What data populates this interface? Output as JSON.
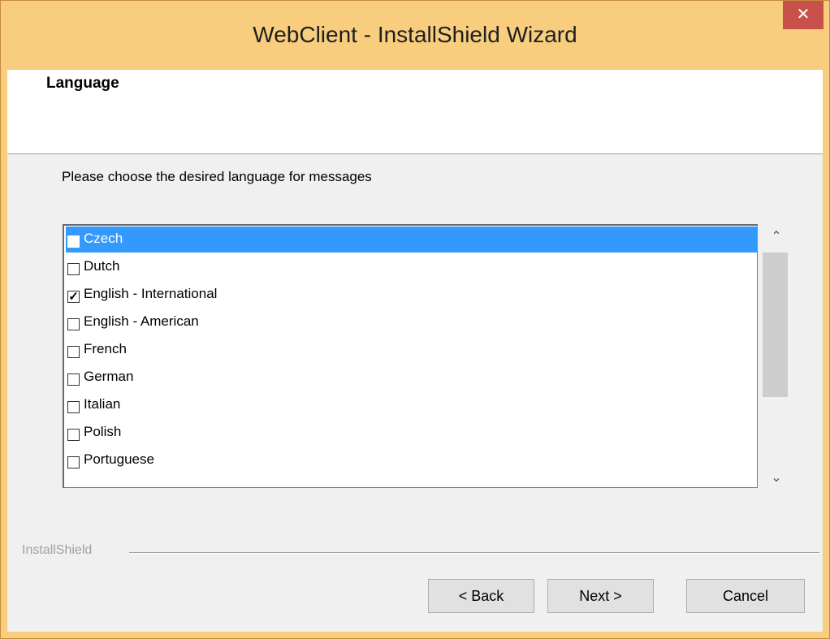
{
  "window": {
    "title": "WebClient - InstallShield Wizard",
    "close_glyph": "✕"
  },
  "header": {
    "title": "Language"
  },
  "instruction": "Please choose the desired language for messages",
  "languages": [
    {
      "label": "Czech",
      "checked": false,
      "selected": true
    },
    {
      "label": "Dutch",
      "checked": false,
      "selected": false
    },
    {
      "label": "English - International",
      "checked": true,
      "selected": false
    },
    {
      "label": "English - American",
      "checked": false,
      "selected": false
    },
    {
      "label": "French",
      "checked": false,
      "selected": false
    },
    {
      "label": "German",
      "checked": false,
      "selected": false
    },
    {
      "label": "Italian",
      "checked": false,
      "selected": false
    },
    {
      "label": "Polish",
      "checked": false,
      "selected": false
    },
    {
      "label": "Portuguese",
      "checked": false,
      "selected": false
    }
  ],
  "scrollbar": {
    "up_glyph": "⌃",
    "down_glyph": "⌄"
  },
  "footer": {
    "brand": "InstallShield"
  },
  "buttons": {
    "back": "< Back",
    "next": "Next >",
    "cancel": "Cancel"
  },
  "colors": {
    "title_bar": "#f8cd7e",
    "selection": "#3399ff",
    "close": "#c7504a"
  }
}
